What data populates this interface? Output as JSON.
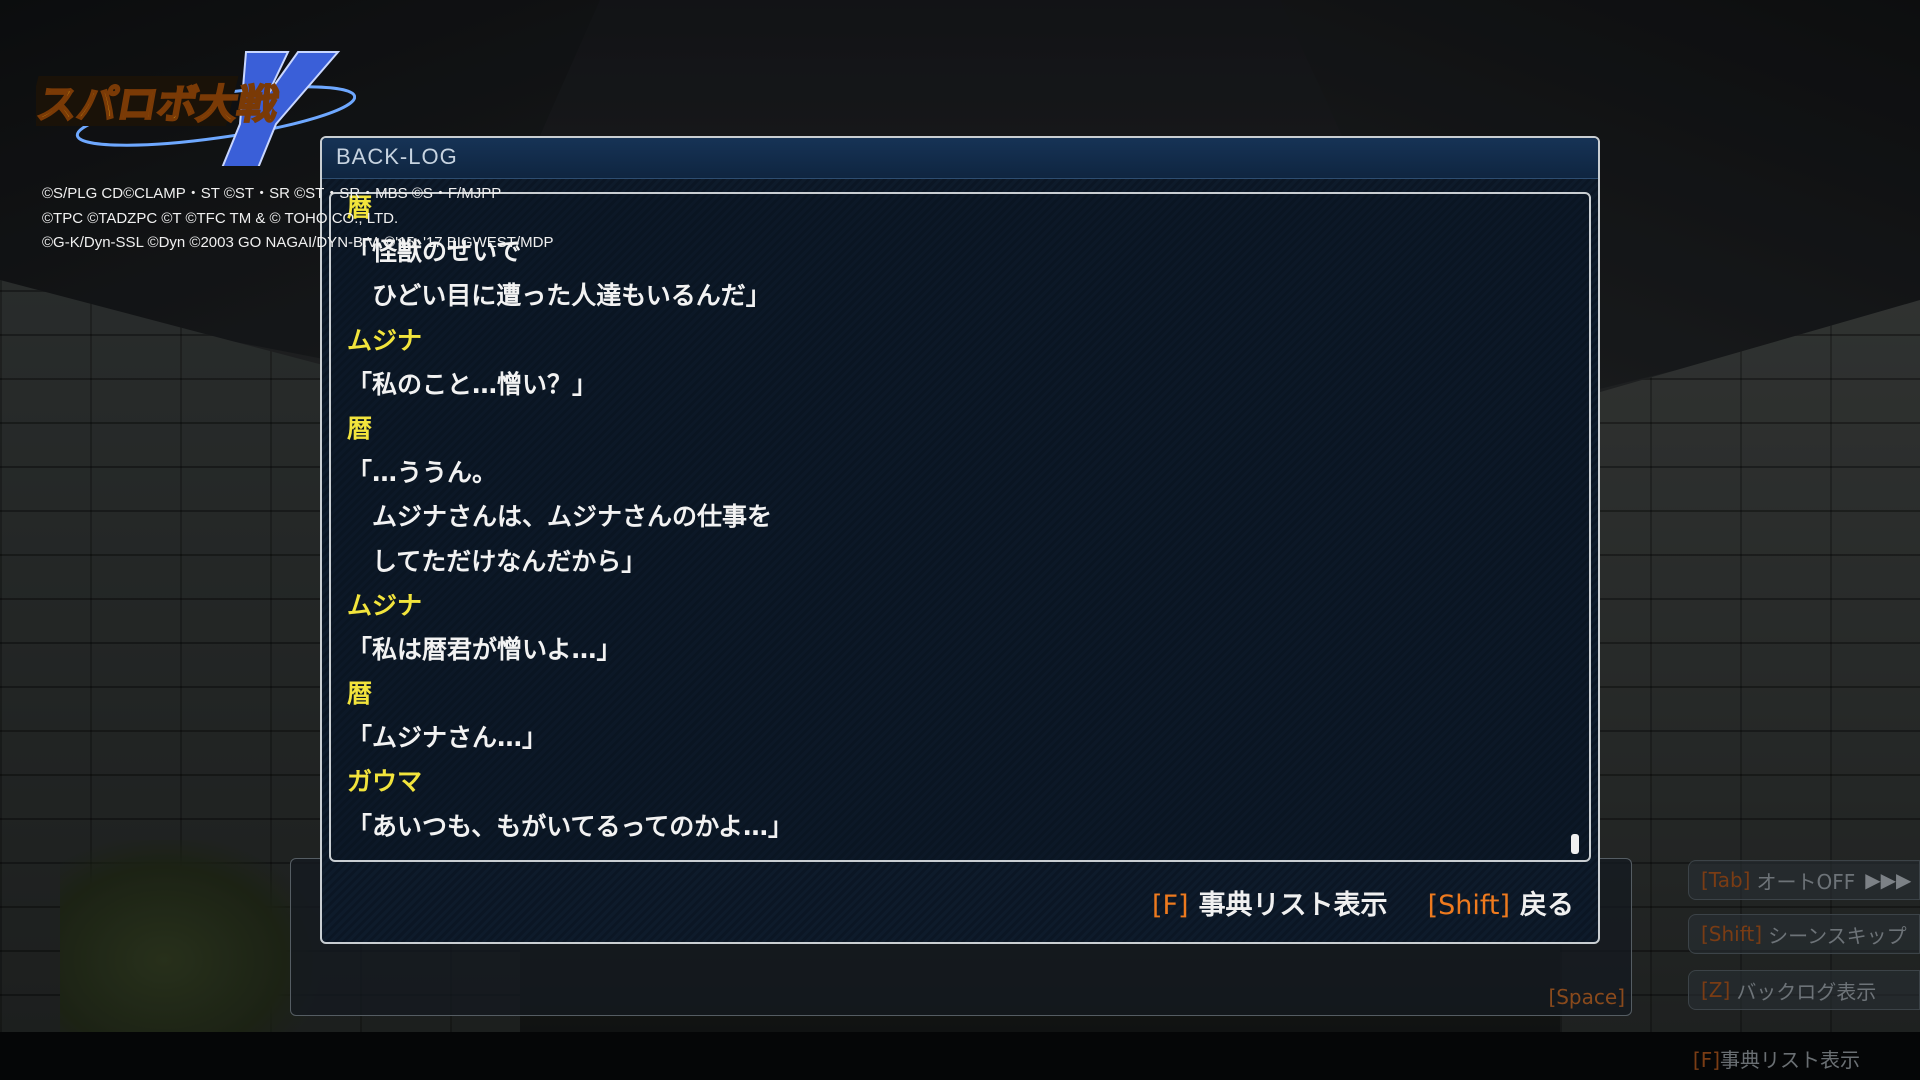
{
  "logo": {
    "alt_text": "スーパーロボット大戦Y",
    "colors": {
      "text": "#f0b21a",
      "y": "#3a5fd8",
      "ring": "#6ea8ff"
    }
  },
  "copyright": [
    "©S/PLG CD©CLAMP・ST ©ST・SR ©ST・SR・MBS ©S・F/MJPP",
    "©TPC ©TADZPC ©T ©TFC TM & © TOHO CO., LTD.",
    "©G-K/Dyn-SSL ©Dyn ©2003 GO NAGAI/DYN-B.V. ©'15, '17 BIGWEST/MDP"
  ],
  "backlog": {
    "title": "BACK-LOG",
    "lines": [
      {
        "type": "speaker",
        "text": "暦"
      },
      {
        "type": "speech",
        "text": "「怪獣のせいで"
      },
      {
        "type": "speech",
        "text": "　ひどい目に遭った人達もいるんだ」"
      },
      {
        "type": "speaker",
        "text": "ムジナ"
      },
      {
        "type": "speech",
        "text": "「私のこと…憎い？」"
      },
      {
        "type": "speaker",
        "text": "暦"
      },
      {
        "type": "speech",
        "text": "「…ううん。"
      },
      {
        "type": "speech",
        "text": "　ムジナさんは、ムジナさんの仕事を"
      },
      {
        "type": "speech",
        "text": "　してただけなんだから」"
      },
      {
        "type": "speaker",
        "text": "ムジナ"
      },
      {
        "type": "speech",
        "text": "「私は暦君が憎いよ…」"
      },
      {
        "type": "speaker",
        "text": "暦"
      },
      {
        "type": "speech",
        "text": "「ムジナさん…」"
      },
      {
        "type": "speaker",
        "text": "ガウマ"
      },
      {
        "type": "speech",
        "text": "「あいつも、もがいてるってのかよ…」"
      }
    ],
    "footer": {
      "dictionary_key": "[F]",
      "dictionary_label": "事典リスト表示",
      "back_key": "[Shift]",
      "back_label": "戻る"
    },
    "colors": {
      "speaker": "#f2e43c",
      "speech": "#f2f2f2",
      "key": "#ee7a1e"
    }
  },
  "message_box": {
    "space_label": "[Space]"
  },
  "side_controls": [
    {
      "key": "[Tab]",
      "label": "オートOFF",
      "arrows": "▶▶▶"
    },
    {
      "key": "[Shift]",
      "label": "シーンスキップ"
    },
    {
      "key": "[Z]",
      "label": "バックログ表示"
    }
  ],
  "bottom_hint": {
    "key": "[F]",
    "label": "事典リスト表示"
  }
}
